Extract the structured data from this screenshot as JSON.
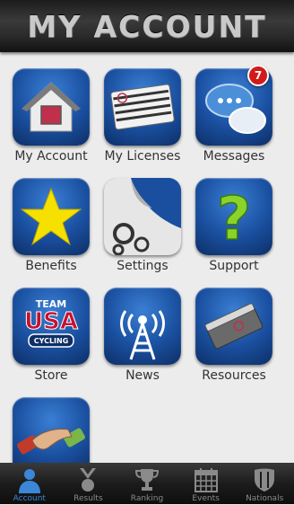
{
  "header": {
    "title": "MY ACCOUNT"
  },
  "tiles": [
    {
      "label": "My Account"
    },
    {
      "label": "My Licenses"
    },
    {
      "label": "Messages",
      "badge": "7"
    },
    {
      "label": "Benefits"
    },
    {
      "label": "Settings"
    },
    {
      "label": "Support"
    },
    {
      "label": "Store",
      "icon_text": [
        "TEAM",
        "USA",
        "CYCLING"
      ]
    },
    {
      "label": "News"
    },
    {
      "label": "Resources"
    },
    {
      "label": ""
    }
  ],
  "tabbar": {
    "tabs": [
      {
        "label": "Account",
        "icon": "person-icon",
        "active": true
      },
      {
        "label": "Results",
        "icon": "medal-icon"
      },
      {
        "label": "Ranking",
        "icon": "trophy-icon"
      },
      {
        "label": "Events",
        "icon": "calendar-icon"
      },
      {
        "label": "Nationals",
        "icon": "shield-icon"
      }
    ]
  },
  "colors": {
    "accent": "#3b86d6",
    "badge": "#d21a1a",
    "tile": "#1a4f9f"
  }
}
